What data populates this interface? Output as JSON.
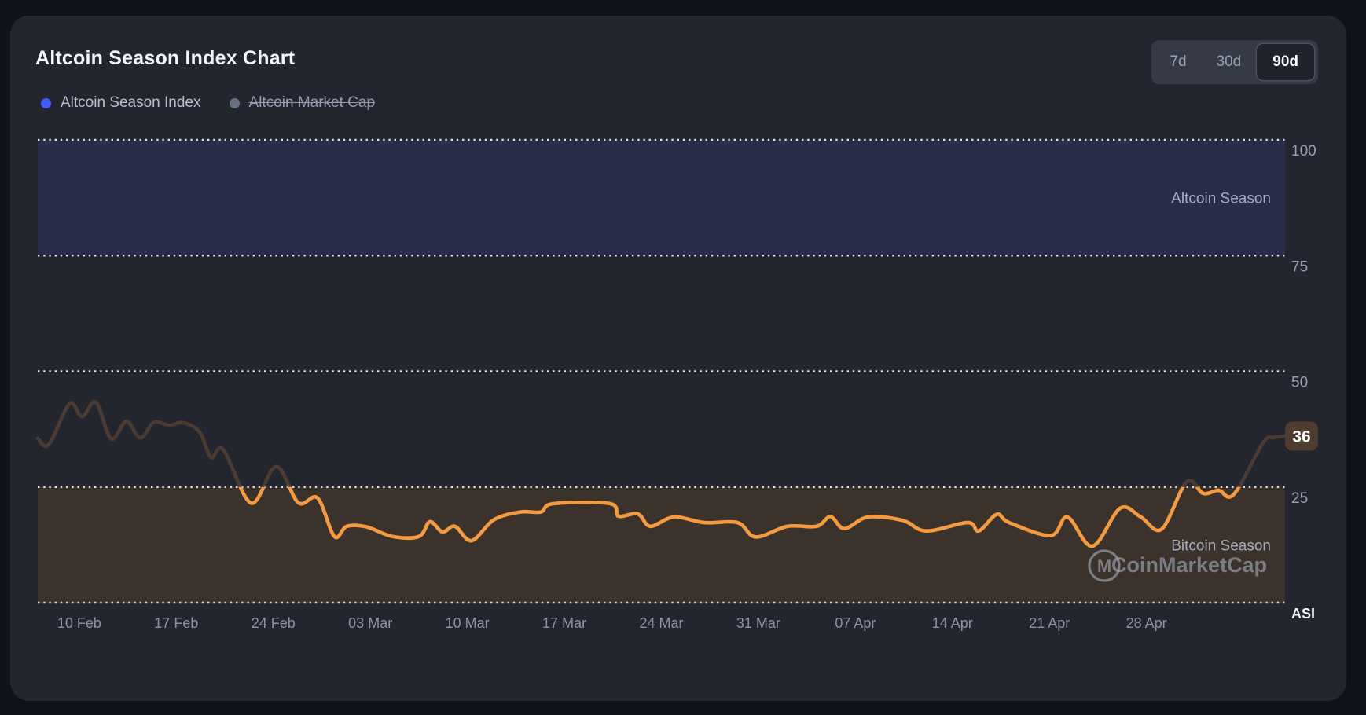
{
  "header": {
    "title": "Altcoin Season Index Chart"
  },
  "range_switcher": {
    "options": [
      {
        "label": "7d",
        "active": false
      },
      {
        "label": "30d",
        "active": false
      },
      {
        "label": "90d",
        "active": true
      }
    ]
  },
  "legend": {
    "items": [
      {
        "label": "Altcoin Season Index",
        "color": "#3E5DFB",
        "active": true
      },
      {
        "label": "Altcoin Market Cap",
        "color": "#6A7084",
        "active": false
      }
    ]
  },
  "chart_data": {
    "type": "line",
    "title": "Altcoin Season Index Chart",
    "ylim": [
      0,
      100
    ],
    "xlim_days": [
      0,
      90
    ],
    "grid_values": [
      100,
      75,
      50,
      25,
      0
    ],
    "y_ticks": [
      {
        "value": 100,
        "label": "100"
      },
      {
        "value": 75,
        "label": "75"
      },
      {
        "value": 50,
        "label": "50"
      },
      {
        "value": 25,
        "label": "25"
      }
    ],
    "y_axis_name": "ASI",
    "x_ticks": [
      {
        "day": 3,
        "label": "10 Feb"
      },
      {
        "day": 10,
        "label": "17 Feb"
      },
      {
        "day": 17,
        "label": "24 Feb"
      },
      {
        "day": 24,
        "label": "03 Mar"
      },
      {
        "day": 31,
        "label": "10 Mar"
      },
      {
        "day": 38,
        "label": "17 Mar"
      },
      {
        "day": 45,
        "label": "24 Mar"
      },
      {
        "day": 52,
        "label": "31 Mar"
      },
      {
        "day": 59,
        "label": "07 Apr"
      },
      {
        "day": 66,
        "label": "14 Apr"
      },
      {
        "day": 73,
        "label": "21 Apr"
      },
      {
        "day": 80,
        "label": "28 Apr"
      }
    ],
    "bands": [
      {
        "label": "Altcoin Season",
        "from": 75,
        "to": 100,
        "color": "#292d4a"
      },
      {
        "label": "Bitcoin Season",
        "from": 0,
        "to": 25,
        "color": "#3b322c"
      }
    ],
    "threshold": 25,
    "series": [
      {
        "name": "Altcoin Season Index",
        "color_below_threshold": "#f49b42",
        "color_above_threshold": "#4c3b33",
        "points": [
          [
            0,
            35.5
          ],
          [
            0.8,
            34.2
          ],
          [
            2.3,
            43.0
          ],
          [
            3.2,
            40.2
          ],
          [
            4.2,
            43.3
          ],
          [
            5.3,
            35.4
          ],
          [
            6.4,
            39.2
          ],
          [
            7.4,
            35.6
          ],
          [
            8.4,
            39.0
          ],
          [
            9.5,
            38.3
          ],
          [
            10.5,
            38.9
          ],
          [
            11.7,
            36.8
          ],
          [
            12.5,
            31.4
          ],
          [
            13.4,
            33.0
          ],
          [
            15.4,
            21.5
          ],
          [
            17.2,
            29.4
          ],
          [
            18.8,
            21.6
          ],
          [
            20.2,
            22.6
          ],
          [
            21.4,
            14.3
          ],
          [
            22.3,
            16.5
          ],
          [
            23.7,
            16.4
          ],
          [
            25.6,
            14.3
          ],
          [
            27.5,
            14.3
          ],
          [
            28.3,
            17.5
          ],
          [
            29.2,
            15.3
          ],
          [
            30.1,
            16.5
          ],
          [
            31.3,
            13.4
          ],
          [
            32.9,
            17.9
          ],
          [
            34.8,
            19.6
          ],
          [
            36.3,
            19.6
          ],
          [
            37.2,
            21.4
          ],
          [
            41.3,
            21.4
          ],
          [
            41.9,
            18.7
          ],
          [
            43.3,
            19.2
          ],
          [
            44.2,
            16.5
          ],
          [
            45.9,
            18.5
          ],
          [
            48.1,
            17.3
          ],
          [
            50.5,
            17.3
          ],
          [
            51.8,
            14.2
          ],
          [
            54.1,
            16.5
          ],
          [
            56.2,
            16.5
          ],
          [
            57.2,
            18.6
          ],
          [
            58.2,
            16.0
          ],
          [
            59.9,
            18.5
          ],
          [
            62.4,
            17.8
          ],
          [
            64.1,
            15.5
          ],
          [
            67.1,
            17.3
          ],
          [
            67.9,
            15.5
          ],
          [
            69.2,
            19.1
          ],
          [
            70.1,
            17.3
          ],
          [
            73.1,
            14.5
          ],
          [
            74.3,
            18.5
          ],
          [
            76.1,
            12.2
          ],
          [
            78.1,
            20.4
          ],
          [
            79.6,
            18.5
          ],
          [
            81.1,
            15.9
          ],
          [
            82.9,
            26.1
          ],
          [
            84.1,
            23.6
          ],
          [
            85.2,
            24.3
          ],
          [
            86.3,
            23.4
          ],
          [
            88.4,
            34.5
          ],
          [
            89.2,
            35.7
          ],
          [
            90,
            36
          ]
        ]
      }
    ],
    "last_value": "36",
    "last_value_badge_color": "#4e3c2e",
    "watermark": "CoinMarketCap",
    "legend_position": "top-left",
    "grid": "dotted-horizontal"
  }
}
